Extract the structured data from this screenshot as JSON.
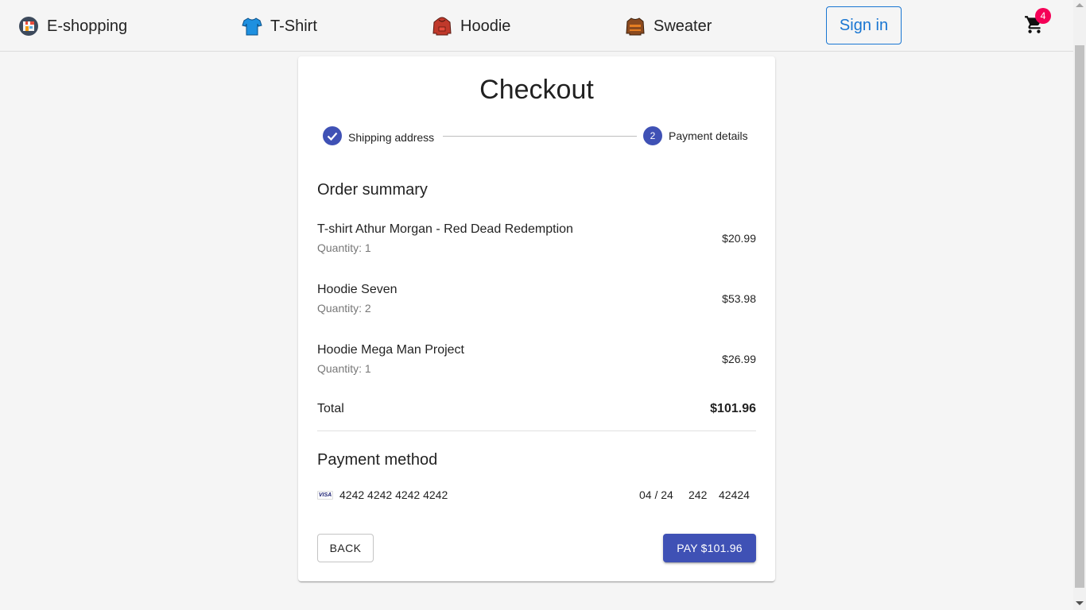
{
  "nav": {
    "brand": {
      "label": "E-shopping",
      "icon": "store-icon"
    },
    "items": [
      {
        "label": "T-Shirt",
        "icon": "tshirt-icon"
      },
      {
        "label": "Hoodie",
        "icon": "hoodie-icon"
      },
      {
        "label": "Sweater",
        "icon": "sweater-icon"
      }
    ],
    "sign_in_label": "Sign in",
    "cart_count": "4",
    "cart_icon": "cart-icon"
  },
  "checkout": {
    "title": "Checkout",
    "steps": [
      {
        "label": "Shipping address",
        "state": "completed"
      },
      {
        "label": "Payment details",
        "number": "2",
        "state": "active"
      }
    ],
    "order_summary_title": "Order summary",
    "items": [
      {
        "name": "T-shirt Athur Morgan - Red Dead Redemption",
        "quantity": "Quantity: 1",
        "price": "$20.99"
      },
      {
        "name": "Hoodie Seven",
        "quantity": "Quantity: 2",
        "price": "$53.98"
      },
      {
        "name": "Hoodie Mega Man Project",
        "quantity": "Quantity: 1",
        "price": "$26.99"
      }
    ],
    "total_label": "Total",
    "total_value": "$101.96",
    "payment_method_title": "Payment method",
    "card": {
      "brand": "VISA",
      "number": "4242 4242 4242 4242",
      "expiry": "04 / 24",
      "cvc": "242",
      "zip": "42424"
    },
    "back_label": "BACK",
    "pay_label": "PAY $101.96"
  },
  "colors": {
    "primary": "#3f51b5",
    "signin_blue": "#1976d2",
    "badge": "#f50057",
    "background": "#f5f5f5"
  }
}
